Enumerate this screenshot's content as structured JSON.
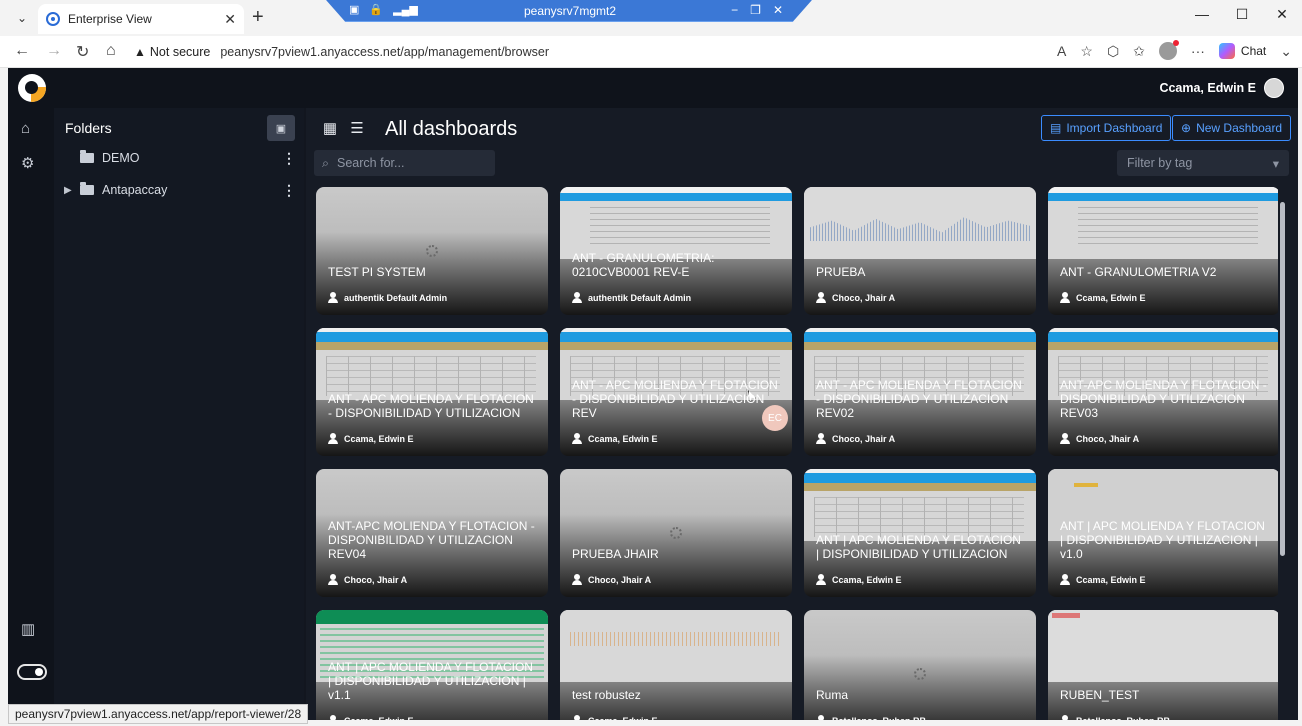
{
  "browser": {
    "tab_title": "Enterprise View",
    "remote_title": "peanysrv7mgmt2",
    "not_secure": "Not secure",
    "url": "peanysrv7pview1.anyaccess.net/app/management/browser",
    "chat_label": "Chat",
    "status_url": "peanysrv7pview1.anyaccess.net/app/report-viewer/28"
  },
  "header": {
    "user_name": "Ccama, Edwin E"
  },
  "folders": {
    "title": "Folders",
    "items": [
      {
        "label": "DEMO"
      },
      {
        "label": "Antapaccay"
      }
    ]
  },
  "main": {
    "title": "All dashboards",
    "import_label": "Import Dashboard",
    "new_label": "New Dashboard",
    "search_placeholder": "Search for...",
    "filter_label": "Filter by tag"
  },
  "dashboards": [
    {
      "title": "TEST PI SYSTEM",
      "owner": "authentik Default Admin",
      "thumb": "spinner"
    },
    {
      "title": "ANT - GRANULOMETRIA: 0210CVB0001 REV-E",
      "owner": "authentik Default Admin",
      "thumb": "report"
    },
    {
      "title": "PRUEBA",
      "owner": "Choco, Jhair A",
      "thumb": "chart"
    },
    {
      "title": "ANT - GRANULOMETRIA V2",
      "owner": "Ccama, Edwin E",
      "thumb": "report"
    },
    {
      "title": "ANT - APC MOLIENDA Y FLOTACION - DISPONIBILIDAD Y UTILIZACION",
      "owner": "Ccama, Edwin E",
      "thumb": "apc"
    },
    {
      "title": "ANT - APC MOLIENDA Y FLOTACION - DISPONIBILIDAD Y UTILIZACION REV",
      "owner": "Ccama, Edwin E",
      "thumb": "apc"
    },
    {
      "title": "ANT - APC MOLIENDA Y FLOTACION - DISPONIBILIDAD Y UTILIZACION REV02",
      "owner": "Choco, Jhair A",
      "thumb": "apc"
    },
    {
      "title": "ANT-APC MOLIENDA Y FLOTACION - DISPONIBILIDAD Y UTILIZACION REV03",
      "owner": "Choco, Jhair A",
      "thumb": "apc"
    },
    {
      "title": "ANT-APC MOLIENDA Y FLOTACION - DISPONIBILIDAD Y UTILIZACION REV04",
      "owner": "Choco, Jhair A",
      "thumb": "blank"
    },
    {
      "title": "PRUEBA JHAIR",
      "owner": "Choco, Jhair A",
      "thumb": "spinner"
    },
    {
      "title": "ANT | APC MOLIENDA Y FLOTACION | DISPONIBILIDAD Y UTILIZACION",
      "owner": "Ccama, Edwin E",
      "thumb": "apc"
    },
    {
      "title": "ANT | APC MOLIENDA Y FLOTACION | DISPONIBILIDAD Y UTILIZACION | v1.0",
      "owner": "Ccama, Edwin E",
      "thumb": "logo"
    },
    {
      "title": "ANT | APC MOLIENDA Y FLOTACION | DISPONIBILIDAD Y UTILIZACION | v1.1",
      "owner": "Ccama, Edwin E",
      "thumb": "green"
    },
    {
      "title": "test robustez",
      "owner": "Ccama, Edwin E",
      "thumb": "test"
    },
    {
      "title": "Ruma",
      "owner": "Batallanos, Ruben RB",
      "thumb": "spinner"
    },
    {
      "title": "RUBEN_TEST",
      "owner": "Batallanos, Ruben RB",
      "thumb": "ruben"
    }
  ],
  "badge": {
    "initials": "EC"
  },
  "colors": {
    "accent": "#3b8cff",
    "app_bg": "#12161f",
    "remote_bar": "#3b78d6"
  }
}
